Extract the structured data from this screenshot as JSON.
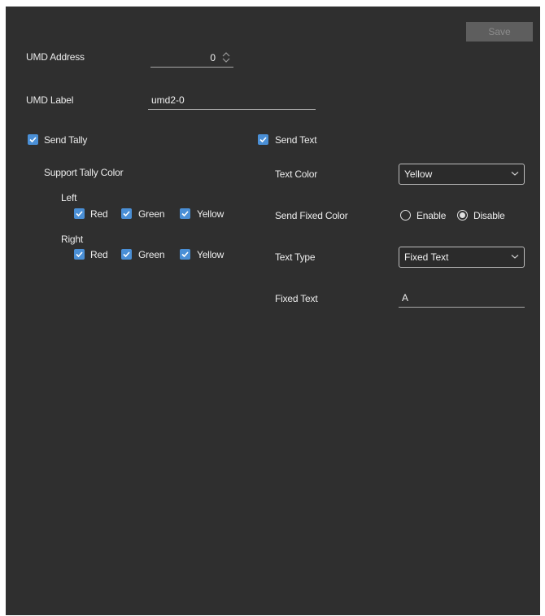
{
  "toolbar": {
    "save_label": "Save"
  },
  "umd": {
    "address_label": "UMD Address",
    "address_value": "0",
    "label_label": "UMD Label",
    "label_value": "umd2-0"
  },
  "tally": {
    "send_label": "Send Tally",
    "support_label": "Support Tally Color",
    "left_label": "Left",
    "right_label": "Right",
    "colors": [
      "Red",
      "Green",
      "Yellow"
    ]
  },
  "text": {
    "send_label": "Send Text",
    "color_label": "Text Color",
    "color_value": "Yellow",
    "fixed_color_label": "Send Fixed Color",
    "enable_label": "Enable",
    "disable_label": "Disable",
    "selected_option": "Disable",
    "type_label": "Text Type",
    "type_value": "Fixed Text",
    "fixed_text_label": "Fixed Text",
    "fixed_text_value": "A"
  },
  "colors": {
    "panel_bg": "#2f2f2f",
    "checkbox_accent": "#4a8fd6"
  }
}
